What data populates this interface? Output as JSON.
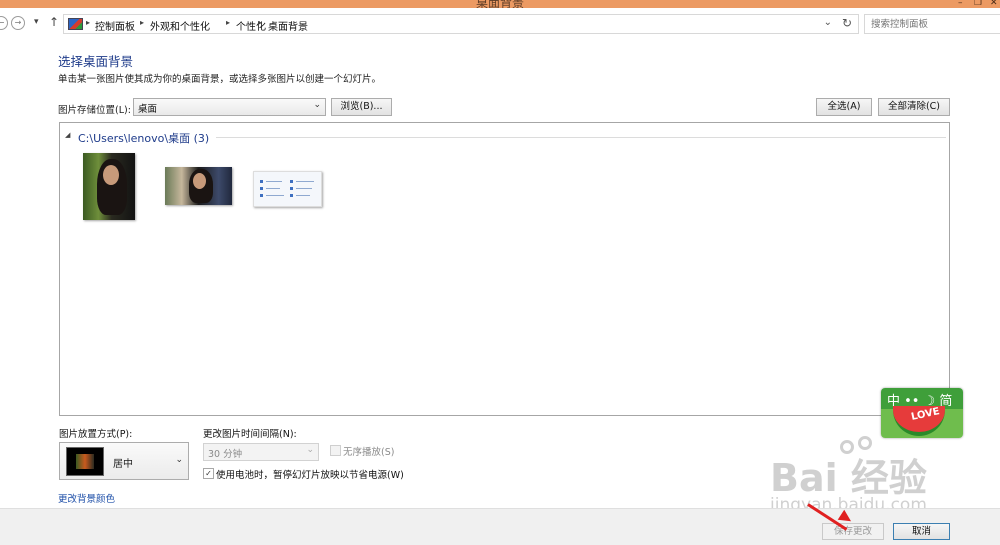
{
  "window": {
    "title": "桌面背景",
    "minimize_glyph": "–",
    "restore_glyph": "❐",
    "close_glyph": "✕"
  },
  "address_bar": {
    "breadcrumbs": [
      "控制面板",
      "外观和个性化",
      "个性化",
      "桌面背景"
    ],
    "separator": "▸",
    "dropdown_glyph": "⌄",
    "refresh_glyph": "↻"
  },
  "nav": {
    "back_glyph": "←",
    "forward_glyph": "→",
    "recent_glyph": "▾",
    "up_glyph": "↑"
  },
  "search": {
    "placeholder": "搜索控制面板"
  },
  "main": {
    "title": "选择桌面背景",
    "subtitle": "单击某一张图片使其成为你的桌面背景，或选择多张图片以创建一个幻灯片。",
    "location_label": "图片存储位置(L):",
    "location_value": "桌面",
    "browse_button": "浏览(B)...",
    "select_all_button": "全选(A)",
    "clear_all_button": "全部清除(C)",
    "dropdown_glyph": "⌄"
  },
  "gallery": {
    "group_title": "C:\\Users\\lenovo\\桌面 (3)",
    "group_glyph": "◢",
    "images": [
      {
        "name": "portrait-woman"
      },
      {
        "name": "landscape-woman"
      },
      {
        "name": "control-panel-screenshot"
      }
    ]
  },
  "position": {
    "label": "图片放置方式(P):",
    "value": "居中"
  },
  "interval": {
    "label": "更改图片时间间隔(N):",
    "value": "30 分钟",
    "shuffle_label": "无序播放(S)",
    "shuffle_checked": false,
    "battery_label": "使用电池时，暂停幻灯片放映以节省电源(W)",
    "battery_checked": true,
    "check_glyph": "✓"
  },
  "change_color_link": "更改背景颜色",
  "footer": {
    "save_button": "保存更改",
    "cancel_button": "取消"
  },
  "ime": {
    "chars": "中 •• ☽ 简",
    "word": "LOVE"
  },
  "watermark": {
    "brand": "Bai 经验",
    "site": "jingyan.baidu.com"
  },
  "colors": {
    "accent": "#1e3b8a",
    "titlebar": "#ec9a63",
    "link": "#1e4fa8",
    "arrow": "#e02020"
  }
}
